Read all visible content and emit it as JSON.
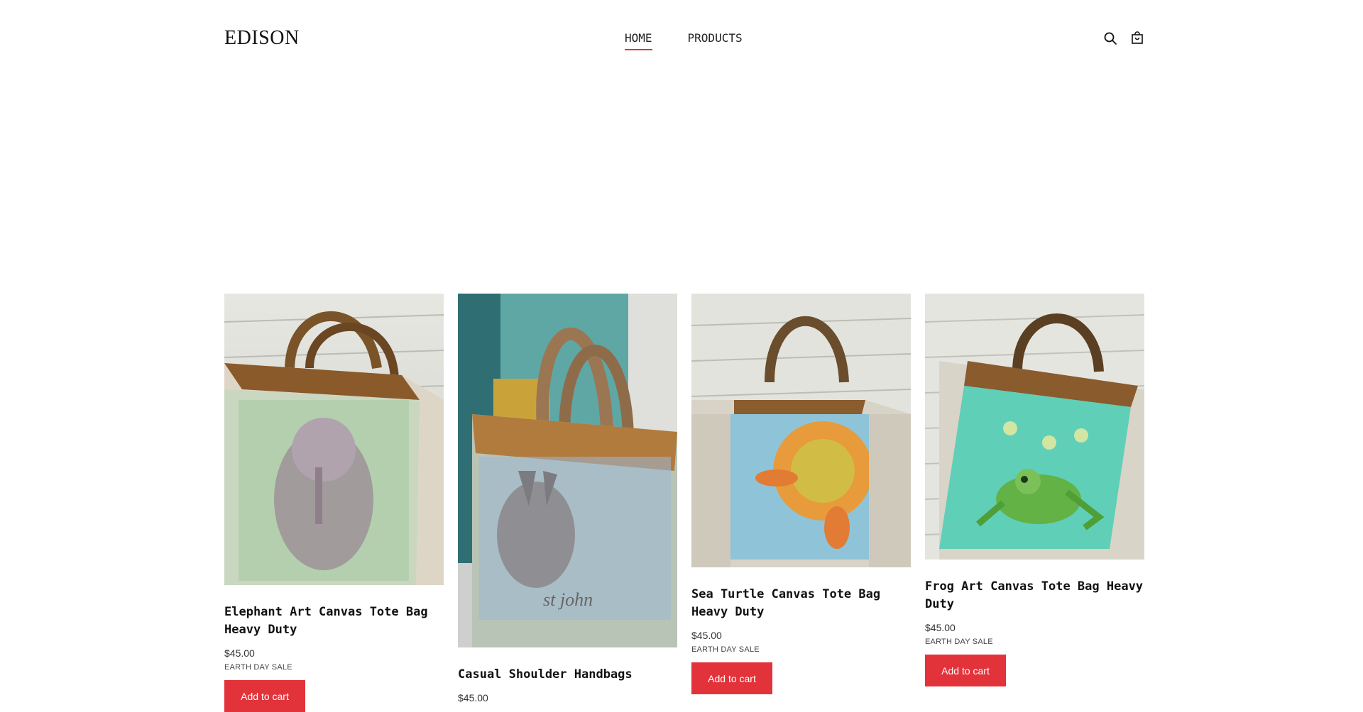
{
  "header": {
    "logo": "EDISON",
    "nav": [
      {
        "label": "HOME",
        "active": true
      },
      {
        "label": "PRODUCTS",
        "active": false
      }
    ],
    "icons": [
      "search-icon",
      "cart-icon"
    ]
  },
  "products": [
    {
      "title": "Elephant Art Canvas Tote Bag Heavy Duty",
      "price": "$45.00",
      "badge": "EARTH DAY SALE",
      "button": "Add to cart"
    },
    {
      "title": "Casual Shoulder Handbags",
      "price": "$45.00",
      "badge": "",
      "button": ""
    },
    {
      "title": "Sea Turtle Canvas Tote Bag Heavy Duty",
      "price": "$45.00",
      "badge": "EARTH DAY SALE",
      "button": "Add to cart"
    },
    {
      "title": "Frog Art Canvas Tote Bag Heavy Duty",
      "price": "$45.00",
      "badge": "EARTH DAY SALE",
      "button": "Add to cart"
    }
  ],
  "colors": {
    "accent": "#e2333b"
  }
}
